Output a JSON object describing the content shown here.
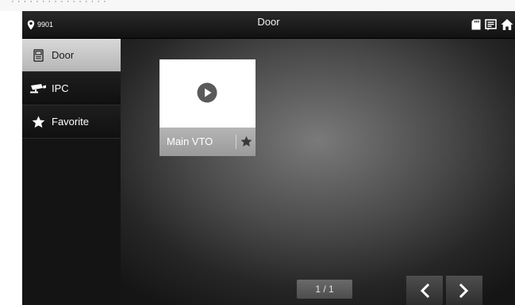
{
  "top_fragment": "· ·    · · · ·  ·  · ·  · · · · ·   ·  ·",
  "statusbar": {
    "location_icon": "location-pin-icon",
    "location_text": "9901",
    "title": "Door",
    "icons": [
      "sd-card-icon",
      "message-icon",
      "home-icon"
    ]
  },
  "sidebar": {
    "items": [
      {
        "label": "Door",
        "icon": "door-phone-icon",
        "active": true
      },
      {
        "label": "IPC",
        "icon": "cctv-camera-icon",
        "active": false
      },
      {
        "label": "Favorite",
        "icon": "star-icon",
        "active": false
      }
    ]
  },
  "devices": [
    {
      "name": "Main VTO",
      "icon": "play-icon",
      "favorite_icon": "star-icon"
    }
  ],
  "pagination": {
    "text": "1 / 1",
    "prev_icon": "chevron-left-icon",
    "next_icon": "chevron-right-icon"
  },
  "colors": {
    "active_tab": "#c8c8c8",
    "topbar": "#1a1a1a",
    "tile_caption": "#a8a8a8"
  }
}
